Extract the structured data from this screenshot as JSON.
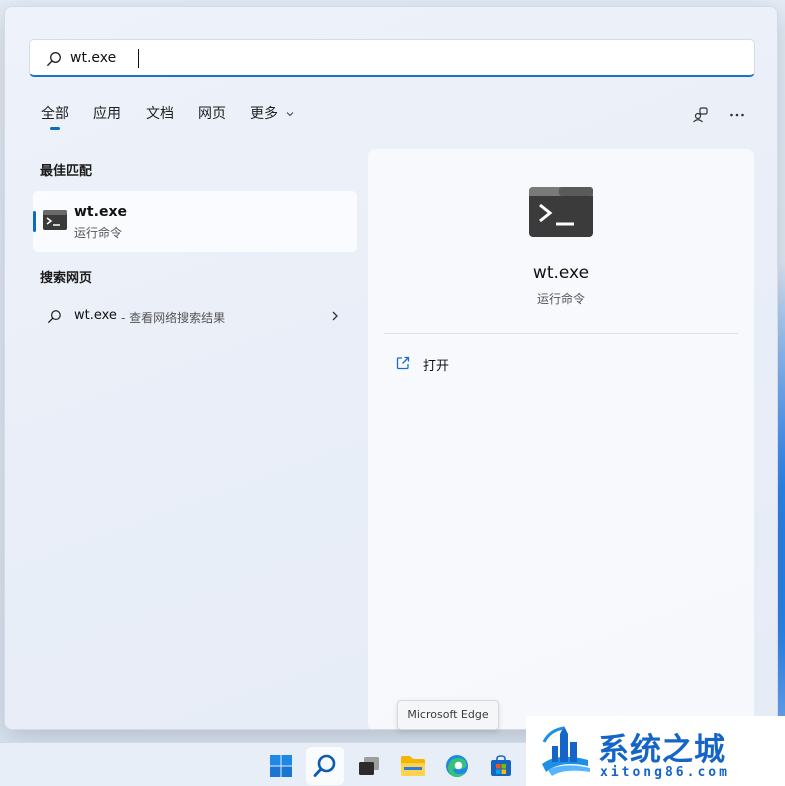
{
  "search": {
    "value": "wt.exe"
  },
  "tabs": [
    {
      "label": "全部",
      "active": true
    },
    {
      "label": "应用",
      "active": false
    },
    {
      "label": "文档",
      "active": false
    },
    {
      "label": "网页",
      "active": false
    },
    {
      "label": "更多",
      "active": false
    }
  ],
  "toolbar": {
    "share_icon": "people-share-icon",
    "more_icon": "more-icon"
  },
  "best_match": {
    "section_title": "最佳匹配",
    "title": "wt.exe",
    "subtitle": "运行命令",
    "icon": "terminal-icon"
  },
  "web_search": {
    "section_title": "搜索网页",
    "query": "wt.exe",
    "hint": "- 查看网络搜索结果"
  },
  "detail": {
    "name": "wt.exe",
    "type": "运行命令",
    "action_label": "打开"
  },
  "tooltip": {
    "text": "Microsoft Edge"
  },
  "taskbar": {
    "items": [
      "windows-start-icon",
      "search-icon",
      "task-view-icon",
      "file-explorer-icon",
      "edge-icon",
      "store-icon"
    ]
  },
  "watermark": {
    "cn": "系统之城",
    "en": "xitong86.com"
  },
  "colors": {
    "accent": "#0f6cbd",
    "watermark": "#1565c8"
  }
}
